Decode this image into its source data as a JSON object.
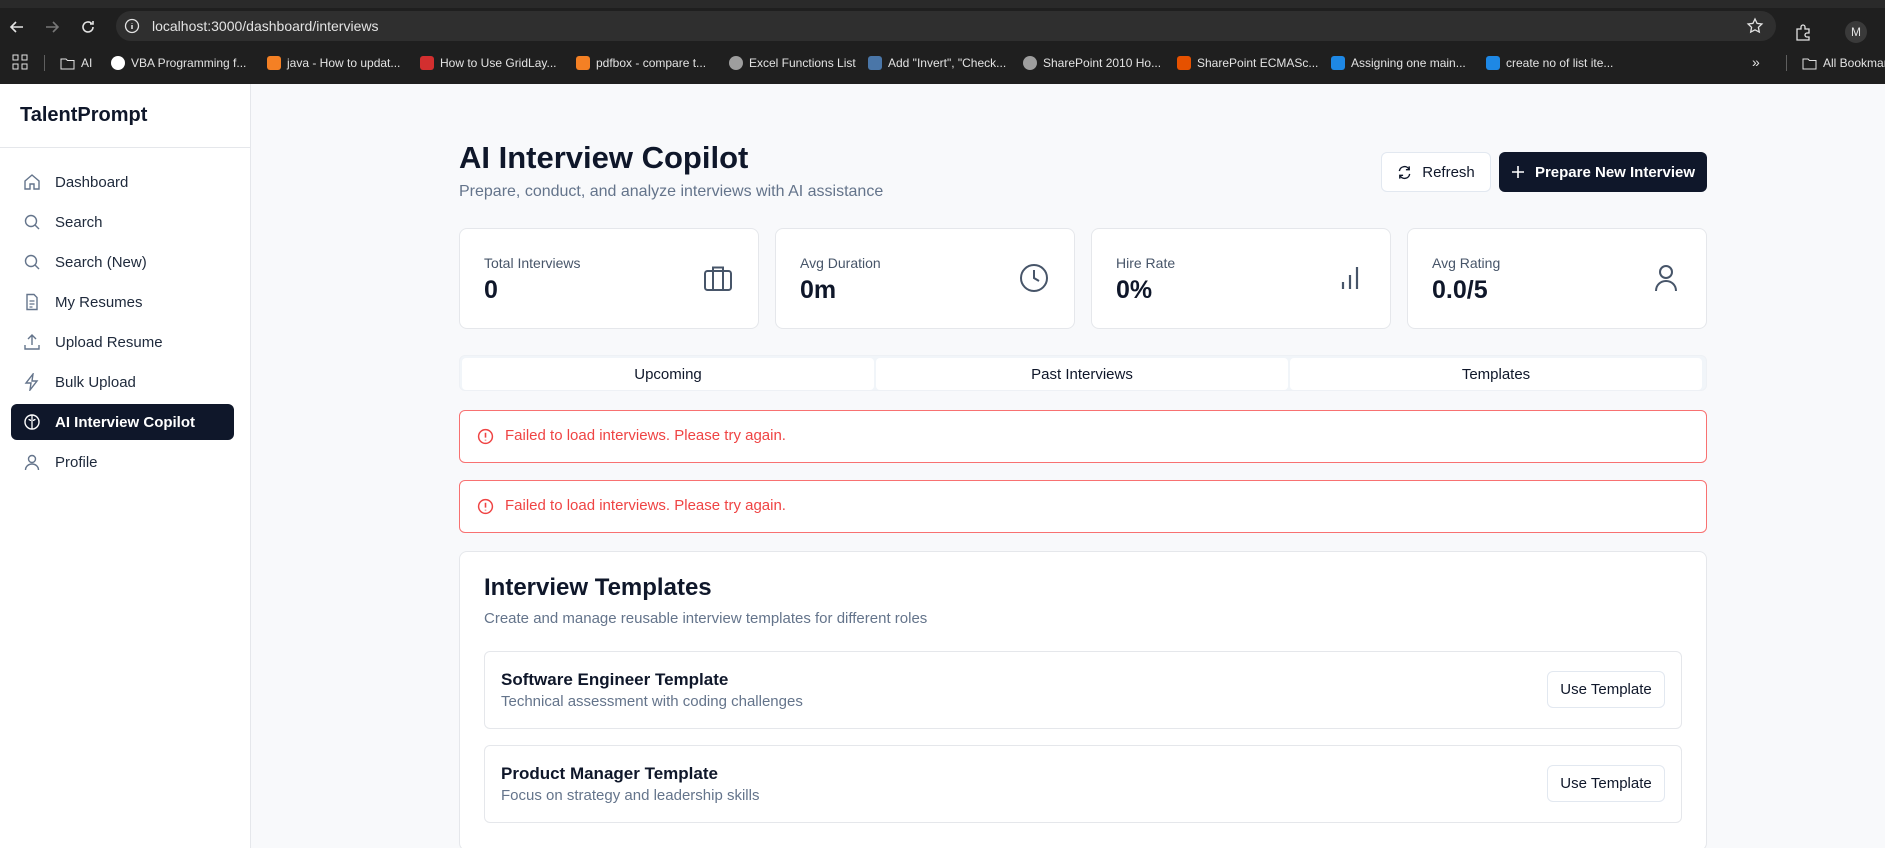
{
  "browser": {
    "url": "localhost:3000/dashboard/interviews",
    "profile_initial": "M",
    "bookmarks": [
      {
        "label": "AI",
        "icon": "folder-icon"
      },
      {
        "label": "VBA Programming f...",
        "icon": "google-icon"
      },
      {
        "label": "java - How to updat...",
        "icon": "stackoverflow-icon"
      },
      {
        "label": "How to Use GridLay...",
        "icon": "oracle-icon"
      },
      {
        "label": "pdfbox - compare t...",
        "icon": "stackoverflow-icon"
      },
      {
        "label": "Excel Functions List",
        "icon": "globe-icon"
      },
      {
        "label": "Add \"Invert\", \"Check...",
        "icon": "site-icon"
      },
      {
        "label": "SharePoint 2010 Ho...",
        "icon": "globe-icon"
      },
      {
        "label": "SharePoint ECMASc...",
        "icon": "site-icon"
      },
      {
        "label": "Assigning one main...",
        "icon": "site-icon"
      },
      {
        "label": "create no of list ite...",
        "icon": "site-icon"
      }
    ],
    "all_bookmarks_label": "All Bookmarks"
  },
  "sidebar": {
    "brand": "TalentPrompt",
    "items": [
      {
        "label": "Dashboard",
        "icon": "home-icon",
        "active": false
      },
      {
        "label": "Search",
        "icon": "search-icon",
        "active": false
      },
      {
        "label": "Search (New)",
        "icon": "search-icon",
        "active": false
      },
      {
        "label": "My Resumes",
        "icon": "file-icon",
        "active": false
      },
      {
        "label": "Upload Resume",
        "icon": "upload-icon",
        "active": false
      },
      {
        "label": "Bulk Upload",
        "icon": "lightning-icon",
        "active": false
      },
      {
        "label": "AI Interview Copilot",
        "icon": "brain-icon",
        "active": true
      },
      {
        "label": "Profile",
        "icon": "user-icon",
        "active": false
      }
    ]
  },
  "header": {
    "title": "AI Interview Copilot",
    "subtitle": "Prepare, conduct, and analyze interviews with AI assistance",
    "refresh_label": "Refresh",
    "prepare_label": "Prepare New Interview"
  },
  "stats": [
    {
      "label": "Total Interviews",
      "value": "0",
      "icon": "briefcase-icon"
    },
    {
      "label": "Avg Duration",
      "value": "0m",
      "icon": "clock-icon"
    },
    {
      "label": "Hire Rate",
      "value": "0%",
      "icon": "bar-chart-icon"
    },
    {
      "label": "Avg Rating",
      "value": "0.0/5",
      "icon": "user-icon"
    }
  ],
  "tabs": [
    "Upcoming",
    "Past Interviews",
    "Templates"
  ],
  "alerts": [
    "Failed to load interviews. Please try again.",
    "Failed to load interviews. Please try again."
  ],
  "templates_card": {
    "title": "Interview Templates",
    "subtitle": "Create and manage reusable interview templates for different roles",
    "items": [
      {
        "name": "Software Engineer Template",
        "description": "Technical assessment with coding challenges",
        "button": "Use Template"
      },
      {
        "name": "Product Manager Template",
        "description": "Focus on strategy and leadership skills",
        "button": "Use Template"
      }
    ]
  },
  "colors": {
    "primary": "#0f172a",
    "error": "#ef4444",
    "error_border": "#f87171",
    "muted_text": "#64748b",
    "page_bg": "#f8f9fb"
  }
}
